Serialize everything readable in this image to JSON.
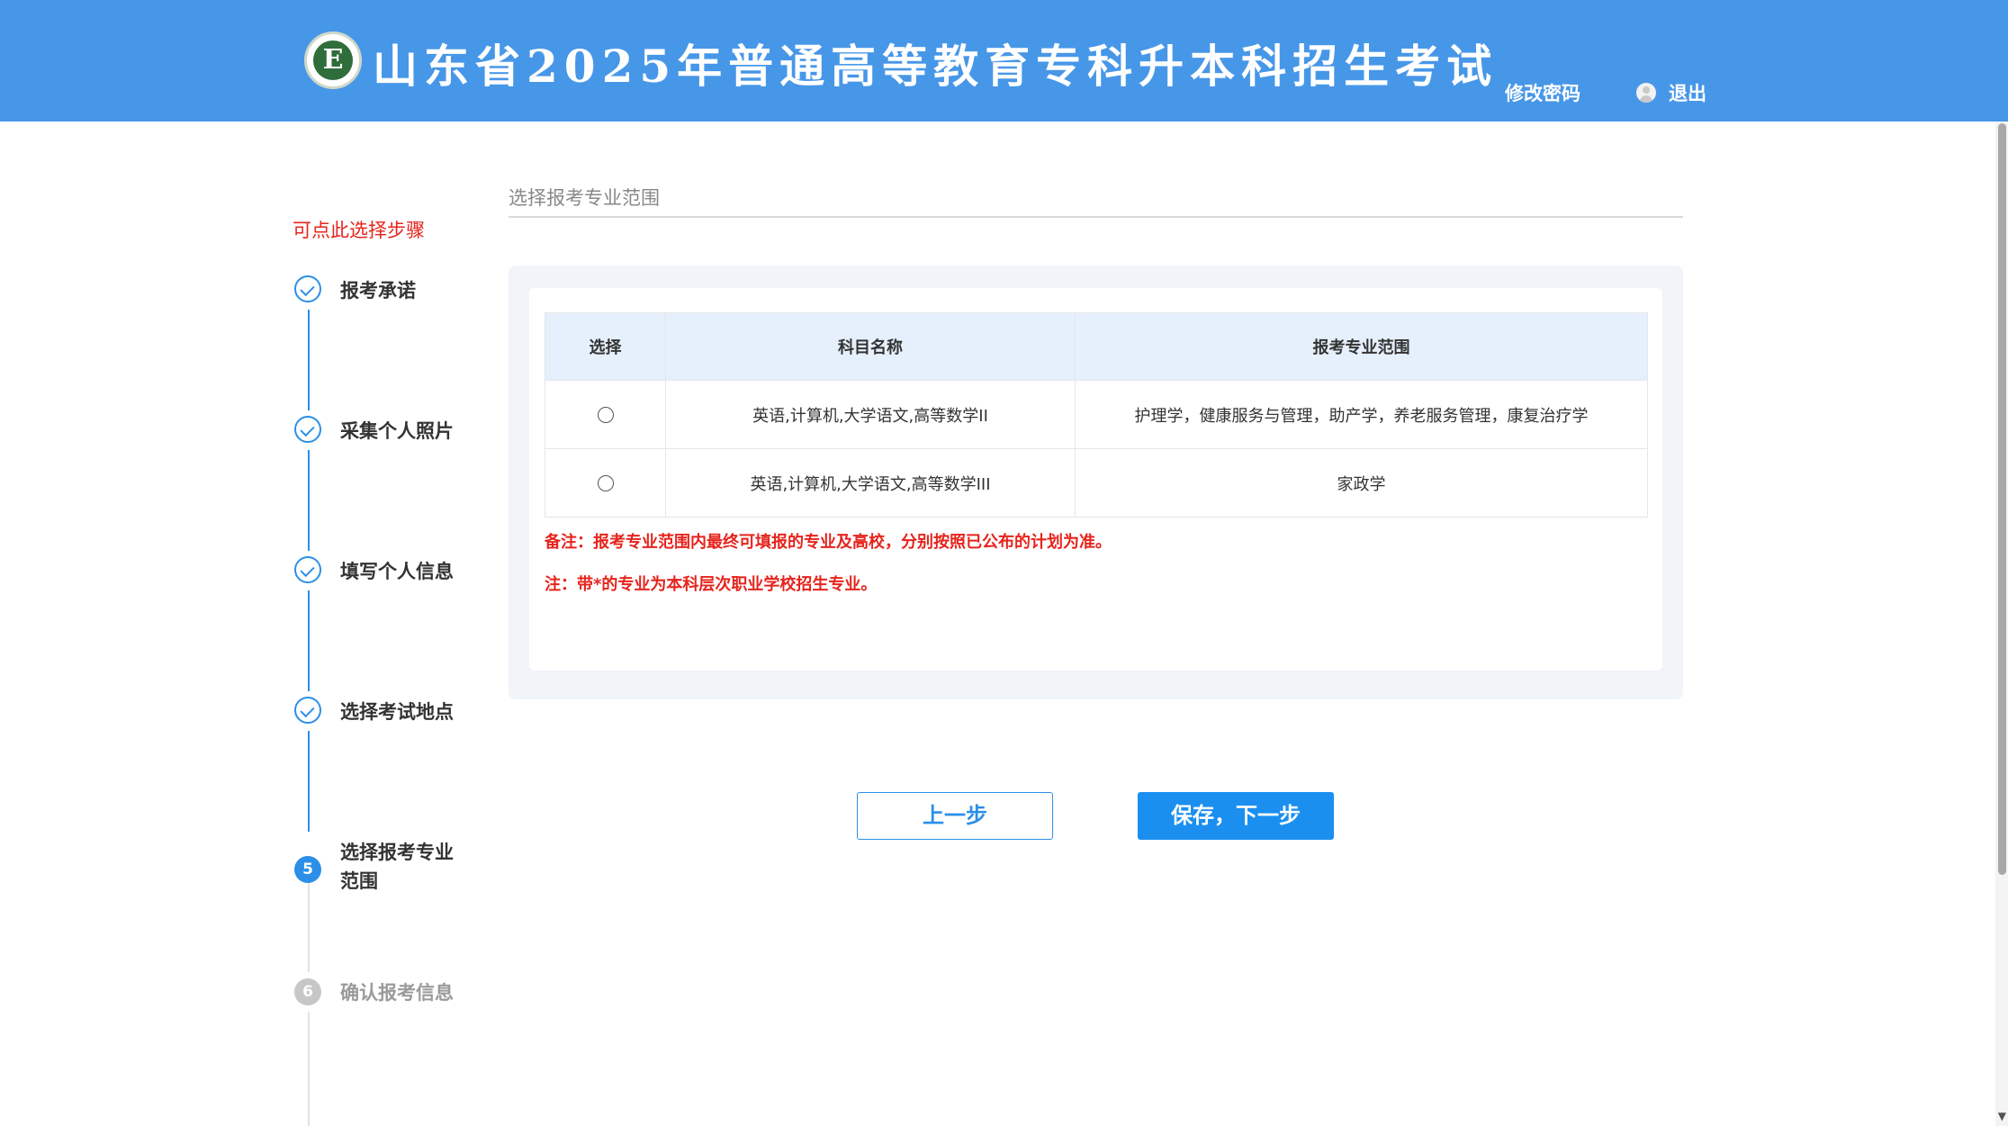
{
  "header": {
    "title": "山东省2025年普通高等教育专科升本科招生考试",
    "logo_letter": "E",
    "change_password": "修改密码",
    "logout": "退出",
    "background_color": "#4797e8"
  },
  "sidebar": {
    "hint": "可点此选择步骤",
    "steps": [
      {
        "number": "1",
        "label": "报考承诺",
        "state": "done"
      },
      {
        "number": "2",
        "label": "采集个人照片",
        "state": "done"
      },
      {
        "number": "3",
        "label": "填写个人信息",
        "state": "done"
      },
      {
        "number": "4",
        "label": "选择考试地点",
        "state": "done"
      },
      {
        "number": "5",
        "label": "选择报考专业范围",
        "state": "active"
      },
      {
        "number": "6",
        "label": "确认报考信息",
        "state": "pending"
      }
    ]
  },
  "main": {
    "section_title": "选择报考专业范围",
    "table": {
      "headers": [
        "选择",
        "科目名称",
        "报考专业范围"
      ],
      "rows": [
        {
          "subjects": "英语,计算机,大学语文,高等数学II",
          "majors": "护理学，健康服务与管理，助产学，养老服务管理，康复治疗学",
          "selected": false
        },
        {
          "subjects": "英语,计算机,大学语文,高等数学III",
          "majors": "家政学",
          "selected": false
        }
      ]
    },
    "notes": [
      "备注：报考专业范围内最终可填报的专业及高校，分别按照已公布的计划为准。",
      "注：带*的专业为本科层次职业学校招生专业。"
    ]
  },
  "buttons": {
    "prev": "上一步",
    "next": "保存，下一步"
  },
  "colors": {
    "accent": "#2b8fe8",
    "warning": "#e6241d"
  }
}
